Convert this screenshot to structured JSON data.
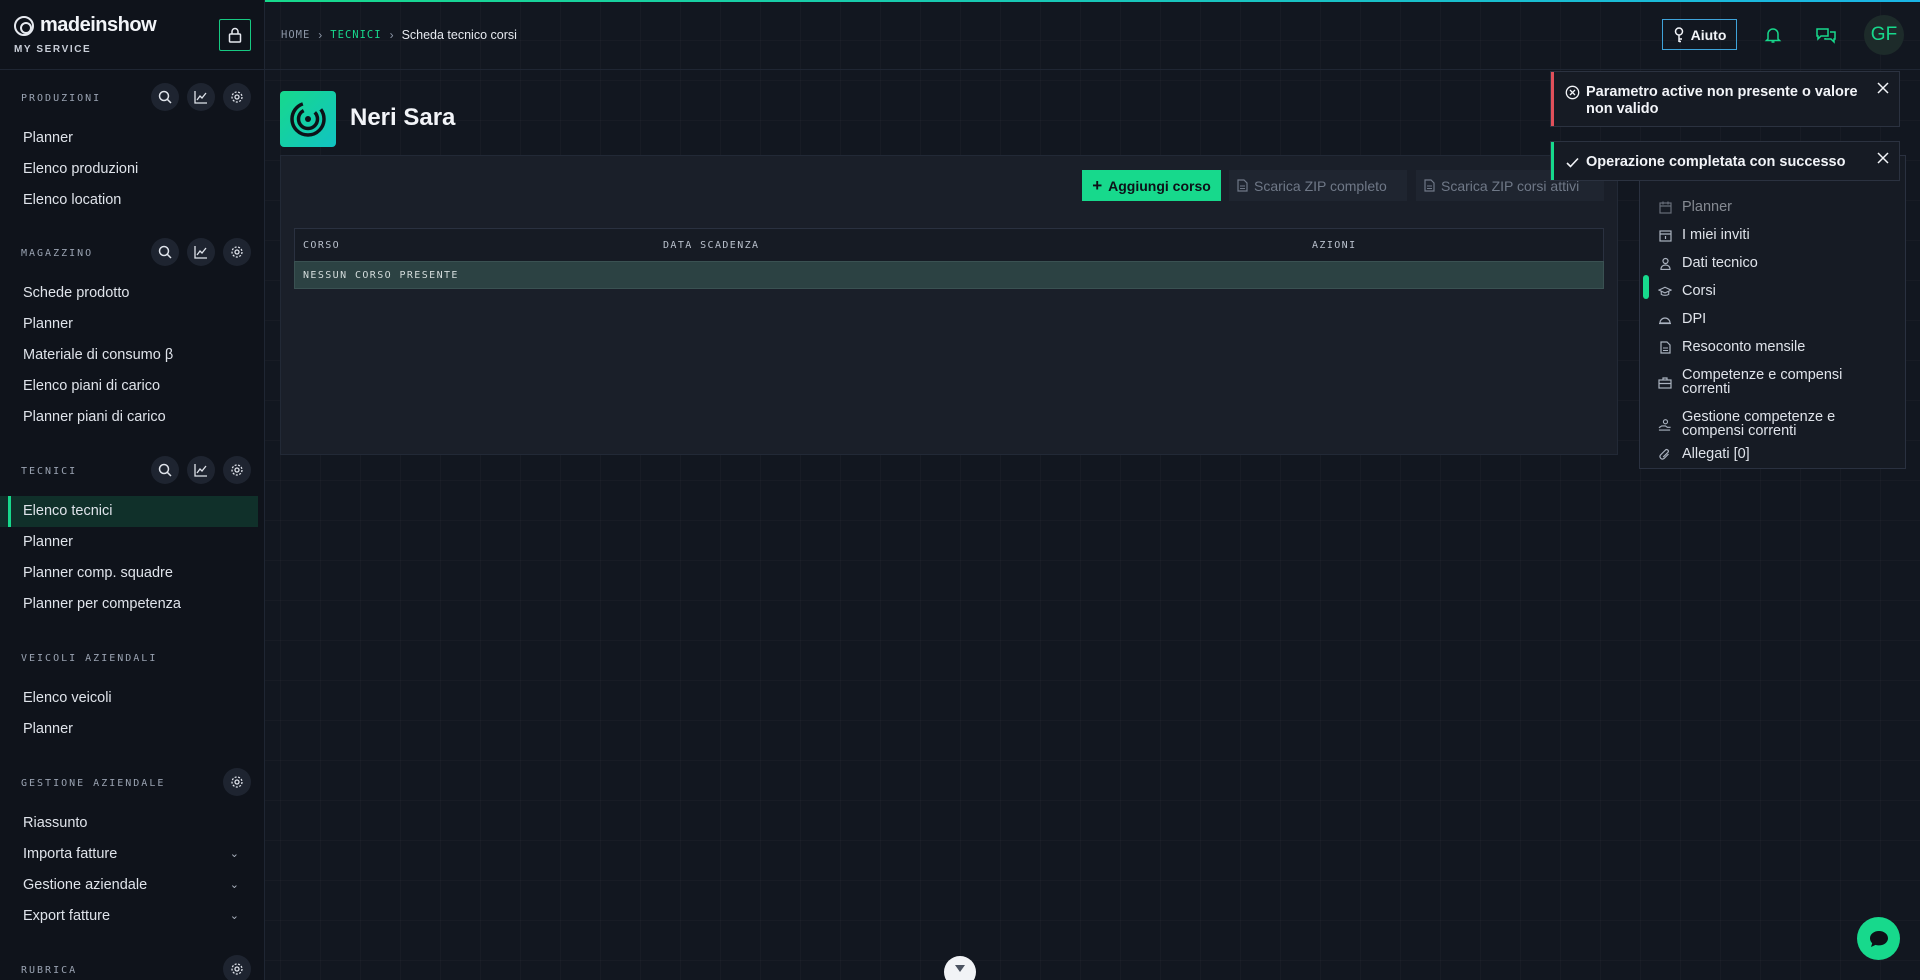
{
  "brand": {
    "name": "madeinshow",
    "subtitle": "MY SERVICE"
  },
  "breadcrumb": {
    "home": "HOME",
    "section": "TECNICI",
    "current": "Scheda tecnico corsi"
  },
  "header": {
    "help_label": "Aiuto",
    "avatar_initials": "GF"
  },
  "sidebar": {
    "produzioni": {
      "title": "PRODUZIONI",
      "items": [
        "Planner",
        "Elenco produzioni",
        "Elenco location"
      ]
    },
    "magazzino": {
      "title": "MAGAZZINO",
      "items": [
        "Schede prodotto",
        "Planner",
        "Materiale di consumo β",
        "Elenco piani di carico",
        "Planner piani di carico"
      ]
    },
    "tecnici": {
      "title": "TECNICI",
      "items": [
        "Elenco tecnici",
        "Planner",
        "Planner comp. squadre",
        "Planner per competenza"
      ],
      "active": "Elenco tecnici"
    },
    "veicoli": {
      "title": "VEICOLI AZIENDALI",
      "items": [
        "Elenco veicoli",
        "Planner"
      ]
    },
    "gestione": {
      "title": "GESTIONE AZIENDALE",
      "items": [
        "Riassunto",
        "Importa fatture",
        "Gestione aziendale",
        "Export fatture"
      ]
    },
    "rubrica": {
      "title": "RUBRICA"
    }
  },
  "page": {
    "title": "Neri Sara"
  },
  "toolbar": {
    "add_label": "Aggiungi corso",
    "zip_full_label": "Scarica ZIP completo",
    "zip_active_label": "Scarica ZIP corsi attivi"
  },
  "table": {
    "columns": [
      "CORSO",
      "DATA SCADENZA",
      "AZIONI"
    ],
    "empty_message": "NESSUN CORSO PRESENTE"
  },
  "submenu": {
    "items": [
      "Planner",
      "I miei inviti",
      "Dati tecnico",
      "Corsi",
      "DPI",
      "Resoconto mensile",
      "Competenze e compensi correnti",
      "Gestione competenze e compensi correnti",
      "Allegati [0]"
    ],
    "active": "Corsi"
  },
  "toasts": [
    {
      "type": "error",
      "message": "Parametro active non presente o valore non valido"
    },
    {
      "type": "success",
      "message": "Operazione completata con successo"
    }
  ],
  "colors": {
    "accent": "#17d98c",
    "error": "#e0505a",
    "background": "#121720"
  }
}
